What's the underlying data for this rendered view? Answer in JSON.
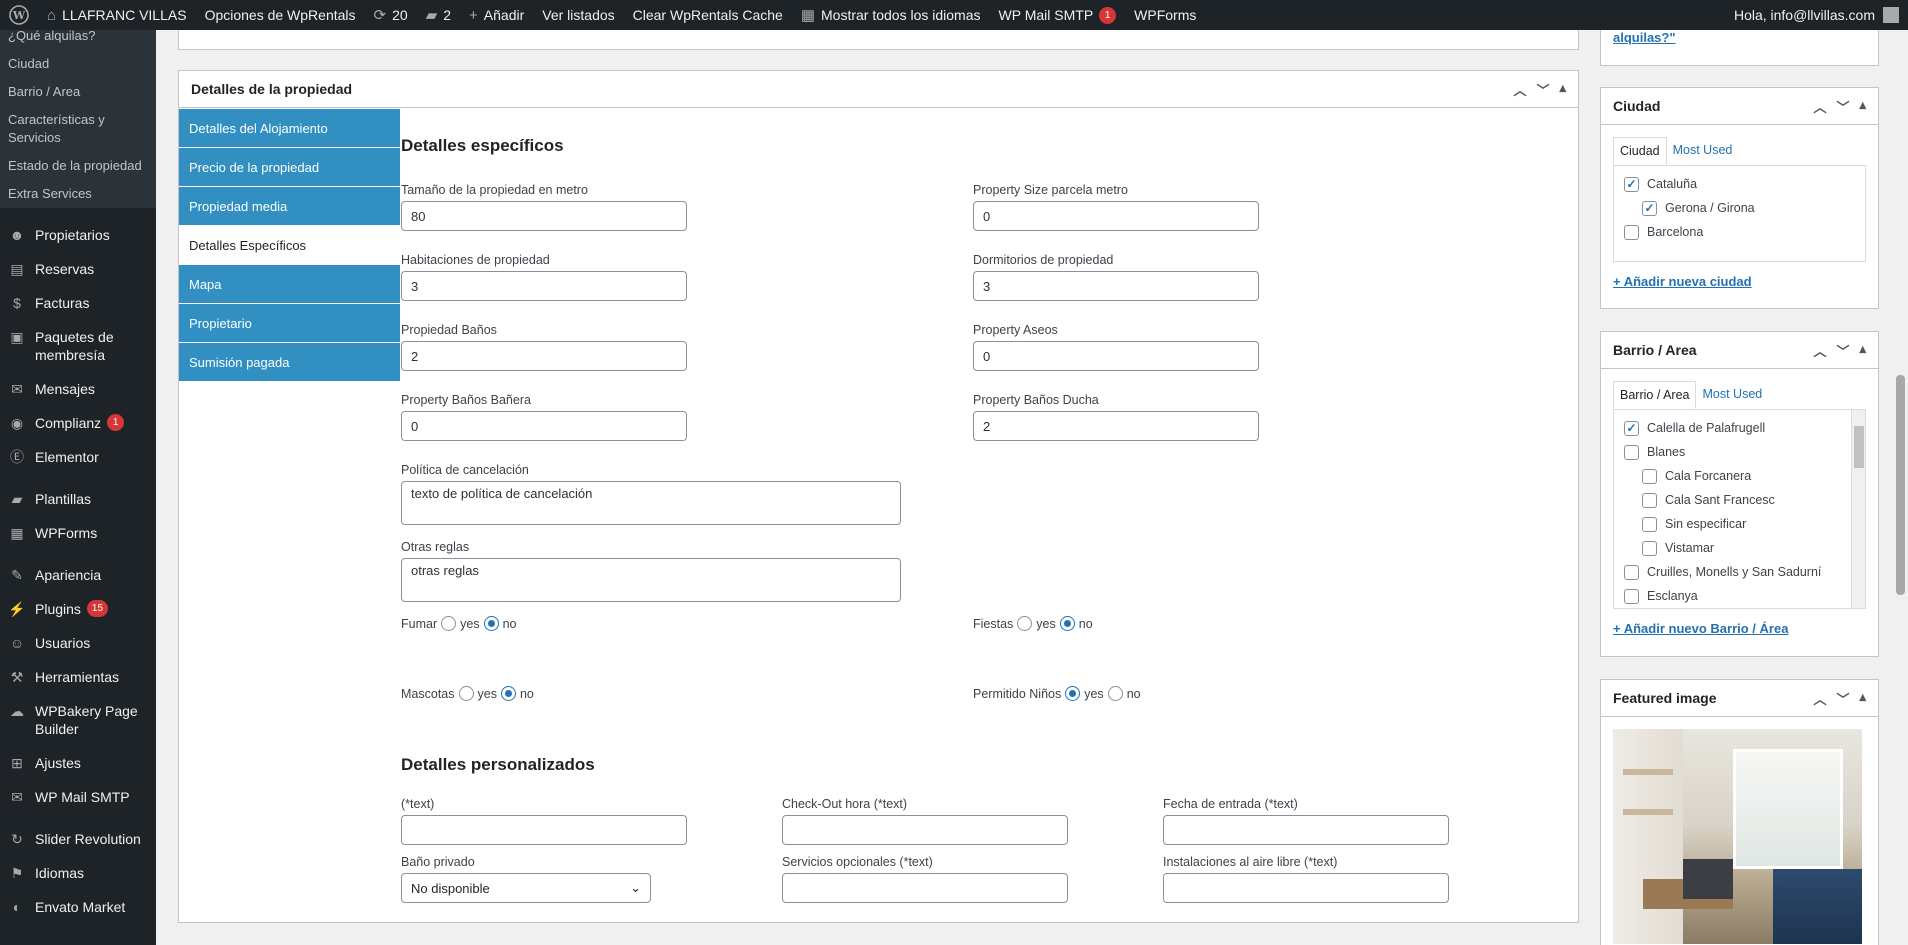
{
  "adminbar": {
    "site_name": "LLAFRANC VILLAS",
    "opciones": "Opciones de WpRentals",
    "updates_count": "20",
    "comments_count": "2",
    "add_new": "Añadir",
    "ver_listados": "Ver listados",
    "clear_cache": "Clear WpRentals Cache",
    "languages": "Mostrar todos los idiomas",
    "wp_mail_smtp": "WP Mail SMTP",
    "wp_mail_smtp_badge": "1",
    "wpforms": "WPForms",
    "greeting": "Hola, info@llvillas.com"
  },
  "sidebar": {
    "submenu": [
      "¿Qué alquilas?",
      "Ciudad",
      "Barrio / Area",
      "Características y Servicios",
      "Estado de la propiedad",
      "Extra Services"
    ],
    "items": [
      {
        "label": "Propietarios",
        "icon": "users-icon"
      },
      {
        "label": "Reservas",
        "icon": "calendar-icon"
      },
      {
        "label": "Facturas",
        "icon": "money-icon"
      },
      {
        "label": "Paquetes de membresía",
        "icon": "package-icon"
      },
      {
        "label": "Mensajes",
        "icon": "messages-icon"
      },
      {
        "label": "Complianz",
        "icon": "complianz-icon",
        "badge": "1"
      },
      {
        "label": "Elementor",
        "icon": "elementor-icon"
      },
      {
        "label": "Plantillas",
        "icon": "folder-icon"
      },
      {
        "label": "WPForms",
        "icon": "wpforms-icon"
      },
      {
        "label": "Apariencia",
        "icon": "brush-icon"
      },
      {
        "label": "Plugins",
        "icon": "plugin-icon",
        "badge": "15"
      },
      {
        "label": "Usuarios",
        "icon": "user-icon"
      },
      {
        "label": "Herramientas",
        "icon": "wrench-icon"
      },
      {
        "label": "WPBakery Page Builder",
        "icon": "wpbakery-icon"
      },
      {
        "label": "Ajustes",
        "icon": "settings-icon"
      },
      {
        "label": "WP Mail SMTP",
        "icon": "mail-icon"
      },
      {
        "label": "Slider Revolution",
        "icon": "slider-icon"
      },
      {
        "label": "Idiomas",
        "icon": "language-icon"
      },
      {
        "label": "Envato Market",
        "icon": "envato-icon"
      }
    ]
  },
  "metabox": {
    "title": "Detalles de la propiedad",
    "tabs": [
      "Detalles del Alojamiento",
      "Precio de la propiedad",
      "Propiedad media",
      "Detalles Específicos",
      "Mapa",
      "Propietario",
      "Sumisión pagada"
    ],
    "section_specific": "Detalles específicos",
    "fields": {
      "size_label": "Tamaño de la propiedad en metro",
      "size_value": "80",
      "plot_label": "Property Size parcela metro",
      "plot_value": "0",
      "rooms_label": "Habitaciones de propiedad",
      "rooms_value": "3",
      "bedrooms_label": "Dormitorios de propiedad",
      "bedrooms_value": "3",
      "baths_label": "Propiedad Baños",
      "baths_value": "2",
      "toilets_label": "Property Aseos",
      "toilets_value": "0",
      "tub_label": "Property Baños Bañera",
      "tub_value": "0",
      "shower_label": "Property Baños Ducha",
      "shower_value": "2",
      "cancel_label": "Política de cancelación",
      "cancel_value": "texto de política de cancelación",
      "rules_label": "Otras reglas",
      "rules_value": "otras reglas"
    },
    "radios": {
      "smoke_label": "Fumar",
      "smoke_value": "no",
      "party_label": "Fiestas",
      "party_value": "no",
      "pets_label": "Mascotas",
      "pets_value": "no",
      "kids_label": "Permitido Niños",
      "kids_value": "yes",
      "yes": "yes",
      "no": "no"
    },
    "section_custom": "Detalles personalizados",
    "custom": {
      "text_label": "(*text)",
      "checkout_label": "Check-Out hora (*text)",
      "checkin_label": "Fecha de entrada (*text)",
      "private_bath_label": "Baño privado",
      "private_bath_value": "No disponible",
      "optional_label": "Servicios opcionales (*text)",
      "outdoor_label": "Instalaciones al aire libre (*text)"
    }
  },
  "ciudad_box": {
    "title": "Ciudad",
    "tab_all": "Ciudad",
    "tab_used": "Most Used",
    "items": [
      {
        "label": "Cataluña",
        "checked": true,
        "indent": 0
      },
      {
        "label": "Gerona / Girona",
        "checked": true,
        "indent": 1
      },
      {
        "label": "Barcelona",
        "checked": false,
        "indent": 0
      }
    ],
    "add_link": "+ Añadir nueva ciudad"
  },
  "barrio_box": {
    "title": "Barrio / Area",
    "tab_all": "Barrio / Area",
    "tab_used": "Most Used",
    "items": [
      {
        "label": "Calella de Palafrugell",
        "checked": true,
        "indent": 0
      },
      {
        "label": "Blanes",
        "checked": false,
        "indent": 0
      },
      {
        "label": "Cala Forcanera",
        "checked": false,
        "indent": 1
      },
      {
        "label": "Cala Sant Francesc",
        "checked": false,
        "indent": 1
      },
      {
        "label": "Sin especificar",
        "checked": false,
        "indent": 1
      },
      {
        "label": "Vistamar",
        "checked": false,
        "indent": 1
      },
      {
        "label": "Cruilles, Monells y San Sadurní",
        "checked": false,
        "indent": 0
      },
      {
        "label": "Esclanya",
        "checked": false,
        "indent": 0
      }
    ],
    "add_link": "+ Añadir nuevo Barrio / Área"
  },
  "top_box": {
    "link_tail": "alquilas?\""
  },
  "featured_box": {
    "title": "Featured image"
  }
}
